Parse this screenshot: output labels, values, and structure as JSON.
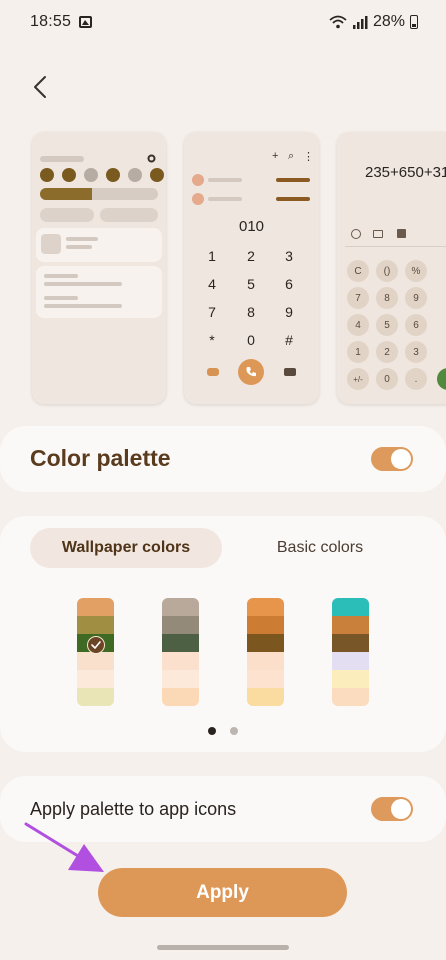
{
  "status_bar": {
    "time": "18:55",
    "battery": "28%"
  },
  "previews": {
    "dialer": {
      "number": "010",
      "keys": [
        "1",
        "2",
        "3",
        "4",
        "5",
        "6",
        "7",
        "8",
        "9",
        "*",
        "0",
        "#"
      ],
      "top_icons": [
        "+",
        "⌕",
        "⋮"
      ]
    },
    "calculator": {
      "expression": "235+650+31",
      "keys": [
        "C",
        "()",
        "%",
        "7",
        "8",
        "9",
        "4",
        "5",
        "6",
        "1",
        "2",
        "3",
        "+/-",
        "0",
        "."
      ]
    }
  },
  "color_palette": {
    "label": "Color palette",
    "enabled": true
  },
  "palette_tabs": [
    {
      "label": "Wallpaper colors",
      "selected": true
    },
    {
      "label": "Basic colors",
      "selected": false
    }
  ],
  "swatches": [
    {
      "colors": [
        "#e2a064",
        "#a08e42",
        "#3f6a24",
        "#f8e0cc",
        "#fde9d9",
        "#e9e5b6"
      ],
      "selected": true
    },
    {
      "colors": [
        "#b9a99a",
        "#938a79",
        "#4d6044",
        "#fbe0cd",
        "#fde9d9",
        "#fcd9b6"
      ],
      "selected": false
    },
    {
      "colors": [
        "#e6954a",
        "#cc7d33",
        "#7b571f",
        "#fbdfcb",
        "#fde3cf",
        "#fbdca0"
      ],
      "selected": false
    },
    {
      "colors": [
        "#2bbdb7",
        "#c8803a",
        "#795628",
        "#e3def2",
        "#fbeebc",
        "#fbdcbe"
      ],
      "selected": false
    }
  ],
  "pagination": {
    "pages": 2,
    "current": 0
  },
  "app_icons": {
    "label": "Apply palette to app icons",
    "enabled": true
  },
  "apply_button": {
    "label": "Apply"
  },
  "colors": {
    "accent": "#dd9858",
    "heading": "#5a3b1e",
    "background": "#f6f0ec",
    "card": "#fbf9f7",
    "cursor": "#b04fe0"
  }
}
